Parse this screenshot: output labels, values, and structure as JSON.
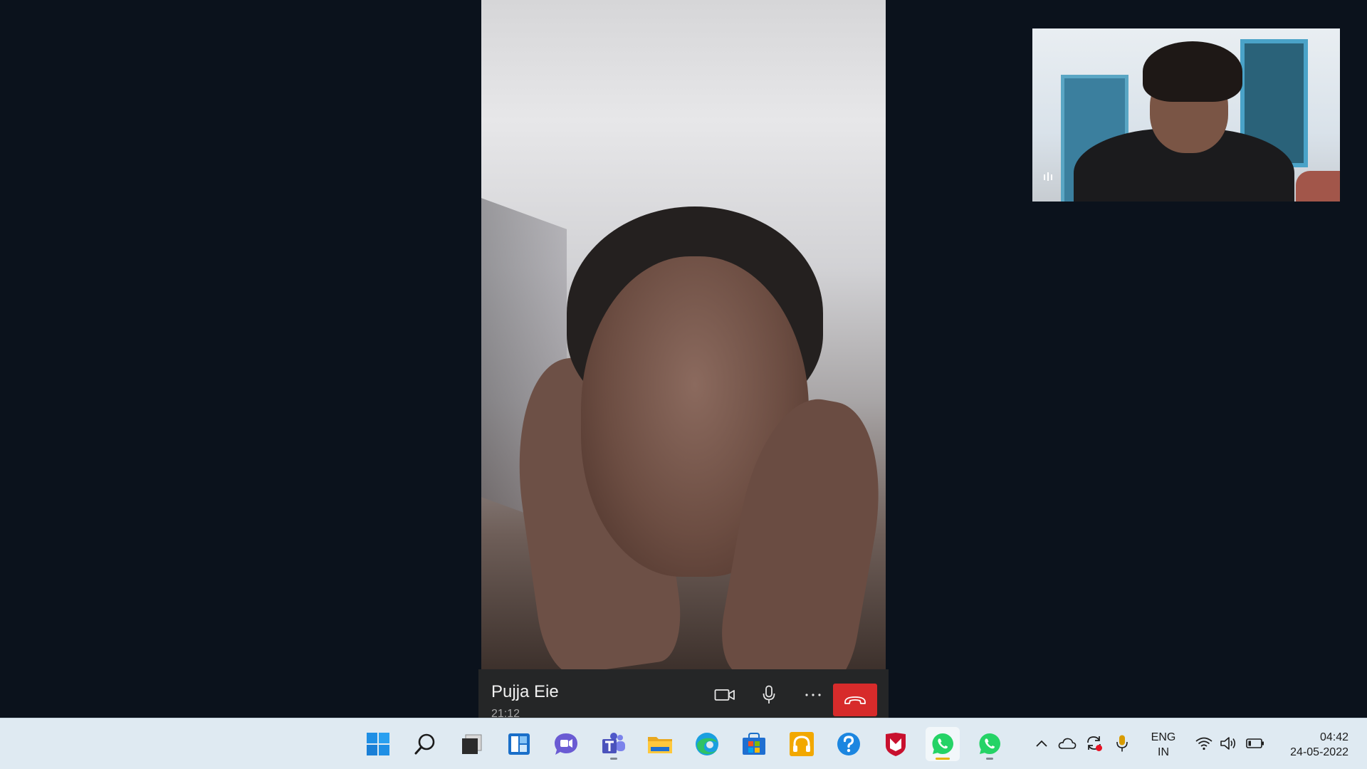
{
  "call": {
    "caller_name": "Pujja Eie",
    "duration": "21:12",
    "controls": {
      "video": "video-camera-icon",
      "mic": "microphone-icon",
      "more": "more-options-icon",
      "end": "end-call-icon"
    },
    "end_call_color": "#d72b2b"
  },
  "taskbar": {
    "apps": [
      "windows-start-icon",
      "search-icon",
      "task-view-icon",
      "widgets-icon",
      "chat-icon",
      "teams-icon",
      "file-explorer-icon",
      "edge-icon",
      "microsoft-store-icon",
      "audible-icon",
      "get-help-icon",
      "mcafee-icon",
      "whatsapp-icon",
      "whatsapp-icon"
    ],
    "tray": {
      "language_line1": "ENG",
      "language_line2": "IN",
      "time": "04:42",
      "date": "24-05-2022"
    }
  }
}
